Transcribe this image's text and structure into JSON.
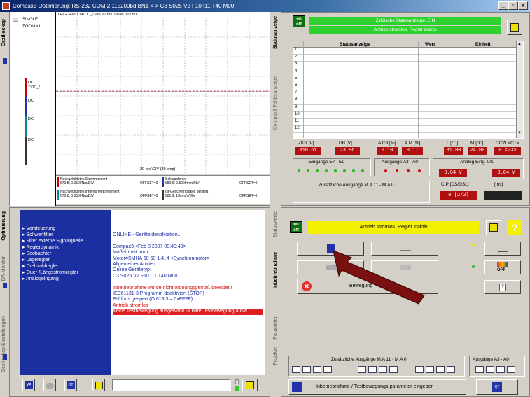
{
  "window": {
    "title": "Compax3 Optimierung: RS-232 COM 2  115200bd BN1 <-> C3 S025 V2 F10 I11 T40 M00",
    "btn_min": "_",
    "btn_max": "▫",
    "btn_close": "x"
  },
  "osc": {
    "tab": "Oszilloskop",
    "single": "SINGLE",
    "zoom": "ZOOM x1",
    "trigger": "TRIGGER: CH1DC_/ Pre 20 ms, Level 0.0050",
    "ch_labels": [
      "DC\nT:DC_/",
      "DC",
      "DC",
      "DC"
    ],
    "timebase": "20 ms \\DIV (80 smp)",
    "channels": [
      {
        "name": "Nachgebildetes Strommoment",
        "scale": "670.5: 0.0500Nm/DIV",
        "offset": "OFFSET=0"
      },
      {
        "name": "Schleppfehler",
        "scale": "680.6: 0.5000mm/DIV",
        "offset": "OFFSET=0"
      },
      {
        "name": "Nachgebildetes inneres Motormoment",
        "scale": "670.6: 0.0500Nm/DIV",
        "offset": "OFFSET=0"
      },
      {
        "name": "Ist-Geschwindigkeit gefiltert",
        "scale": "681.9: 10mm/s/DIV",
        "offset": "OFFSET=0"
      }
    ]
  },
  "status": {
    "tab1": "Statusanzeige",
    "tab2": "Compax3 Fehleranzeige",
    "on": "on",
    "off": "off",
    "bar1": "Zyklische Statusanzeige: EIN",
    "bar2": "Antrieb stromlos, Regler inaktiv",
    "cols": [
      "Statusanzeige",
      "Wert",
      "Einheit"
    ],
    "rows": [
      "1",
      "2",
      "3",
      "4",
      "5",
      "6",
      "7",
      "8",
      "9",
      "10",
      "11",
      "12"
    ],
    "meters": [
      {
        "label": "ZKS [V]",
        "value": "310.61"
      },
      {
        "label": "UB [V]",
        "value": "23.96"
      },
      {
        "label": "A C3 [%]",
        "value": "0.10"
      },
      {
        "label": "A M [%]",
        "value": "0.17"
      },
      {
        "label": "L [°C]",
        "value": "31.00"
      },
      {
        "label": "M [°C]",
        "value": "24.00"
      },
      {
        "label": "CCW <CT>",
        "value": "0 <23>"
      }
    ],
    "inputs_label": "Eingänge E7 - E0",
    "outputs_label": "Ausgänge A3 - A0",
    "analog_label": "Analog Eing. 0/1",
    "analog0": "0.04 V",
    "analog1": "0.04 V",
    "extra_out": "Zusätzliche Ausgänge M.A 11 - M.A 0",
    "cip": "CIP [DS/DSL]",
    "ms": "[ms]",
    "cip_val": "0 [2/2]"
  },
  "opt": {
    "tab1": "Optimierung",
    "tab2": "DA-Monitor",
    "tab3": "Oszilloskop Einstellungen",
    "items": [
      "Vorsteuerung",
      "Sollwertfilter",
      "Filter externe Signalquelle",
      "Reglerdynamik",
      "Beobachter",
      "Lageregler",
      "Drehzahlregler",
      "Quer-/Längsstromregler",
      "Analogeingang"
    ],
    "log": [
      "ONLINE - Geräteidentifikation..",
      "",
      "Compax3 <Feb  8 2007 08:40:48>",
      "Maßeinheit: mm",
      "Motor=SMHA 60 60 1,4..4 <Synchronmotor>",
      "Allgemeiner Antrieb",
      "Online Gerätetyp:",
      "C3 S025 V2 F10 I11 T40 M00",
      "",
      "Inbetriebnahme wurde nicht ordnungsgemäß beendet !",
      "IEC61131-3 Programm deaktiviert (STOP)",
      "Feldbus gespert (O 819.3 = 0xFFFF)",
      "Antrieb stromlos"
    ],
    "log_highlight": "Keine Testbewegung ausgewählt -> Bitte Testbewegung ausw",
    "vf": "VF",
    "qt": "QT"
  },
  "comm": {
    "tab1": "Statuswerte",
    "tab2": "Inbetriebnahme",
    "tab3": "Parameter",
    "tab4": "Projekte",
    "on": "on",
    "off": "off",
    "bar": "Antrieb stromlos, Regler inaktiv",
    "bewegung": "Bewegung",
    "off_label": "OFF",
    "extra_out": "Zusätzliche Ausgänge M.A 11 - M.A 0",
    "out_a": "Ausgänge A3 - A0",
    "param": "Inbetriebnahme-/ Testbewegungs-parameter eingeben",
    "qt": "QT"
  },
  "colors": {
    "arrow": "#7a1010",
    "green": "#2ed12e",
    "yellow": "#f4f000",
    "blue": "#2233aa",
    "digit": "#b01010"
  }
}
